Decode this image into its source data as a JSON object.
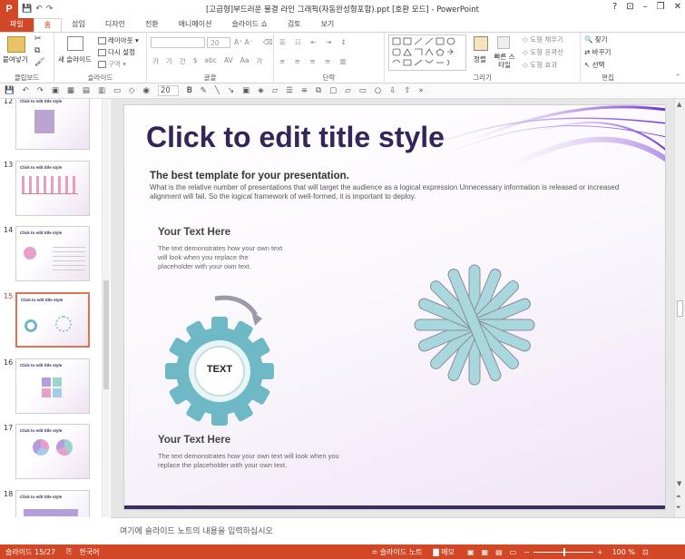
{
  "app": {
    "logo": "P",
    "title": "[고급형]부드러운 물결 라인 그래픽(자동완성형포함).ppt [호환 모드] - PowerPoint",
    "win_controls": [
      "?",
      "⊡",
      "–",
      "❐",
      "✕"
    ]
  },
  "tabs": [
    "파일",
    "홈",
    "삽입",
    "디자인",
    "전환",
    "애니메이션",
    "슬라이드 쇼",
    "검토",
    "보기"
  ],
  "active_tab": "홈",
  "ribbon": {
    "clipboard": {
      "paste": "붙여넣기",
      "label": "클립보드"
    },
    "slides": {
      "new_slide": "새 슬라이드",
      "layout": "레이아웃",
      "reset": "다시 설정",
      "section": "구역",
      "label": "슬라이드"
    },
    "font": {
      "size": "20",
      "label": "글꼴",
      "buttons": [
        "가",
        "가",
        "간",
        "$",
        "abc",
        "AV",
        "Aa",
        "가"
      ]
    },
    "paragraph": {
      "label": "단락"
    },
    "drawing": {
      "arrange": "정렬",
      "quick_styles": "빠른 스타일",
      "fill": "도형 채우기",
      "outline": "도형 윤곽선",
      "effects": "도형 효과",
      "label": "그리기"
    },
    "editing": {
      "find": "찾기",
      "replace": "바꾸기",
      "select": "선택",
      "label": "편집"
    }
  },
  "qat": {
    "font_size": "20"
  },
  "thumbnails": [
    {
      "num": "12",
      "title": "Click to edit title style",
      "active": false
    },
    {
      "num": "13",
      "title": "Click to edit title style",
      "active": false
    },
    {
      "num": "14",
      "title": "Click to edit title style",
      "active": false
    },
    {
      "num": "15",
      "title": "Click to edit title style",
      "active": true
    },
    {
      "num": "16",
      "title": "Click to edit title style",
      "active": false
    },
    {
      "num": "17",
      "title": "Click to edit title style",
      "active": false
    },
    {
      "num": "18",
      "title": "Click to edit title style",
      "active": false
    }
  ],
  "slide": {
    "title": "Click to edit title style",
    "subtitle": "The best template for your presentation.",
    "body": "What is the relative number of presentations that will target the audience as a logical expression Unnecessary information is released or increased alignment will fail. So the logical framework of well-formed, it is important to deploy.",
    "block1": {
      "heading": "Your Text Here",
      "text": "The text demonstrates how your own text will look when you replace the placeholder with your own text."
    },
    "gear_label": "TEXT",
    "block2": {
      "heading": "Your Text Here",
      "text": "The text demonstrates how your own text will look when you replace the placeholder with your own text."
    },
    "colors": {
      "title": "#33265a",
      "gear": "#6fb9c7",
      "flower": "#a8d8dd",
      "accent": "#8a2be2"
    }
  },
  "notes_placeholder": "여기에 슬라이드 노트의 내용을 입력하십시오",
  "status": {
    "slide_info": "슬라이드 15/27",
    "language": "한국어",
    "notes_btn": "슬라이드 노트",
    "comments_btn": "메모",
    "zoom": "100 %"
  }
}
